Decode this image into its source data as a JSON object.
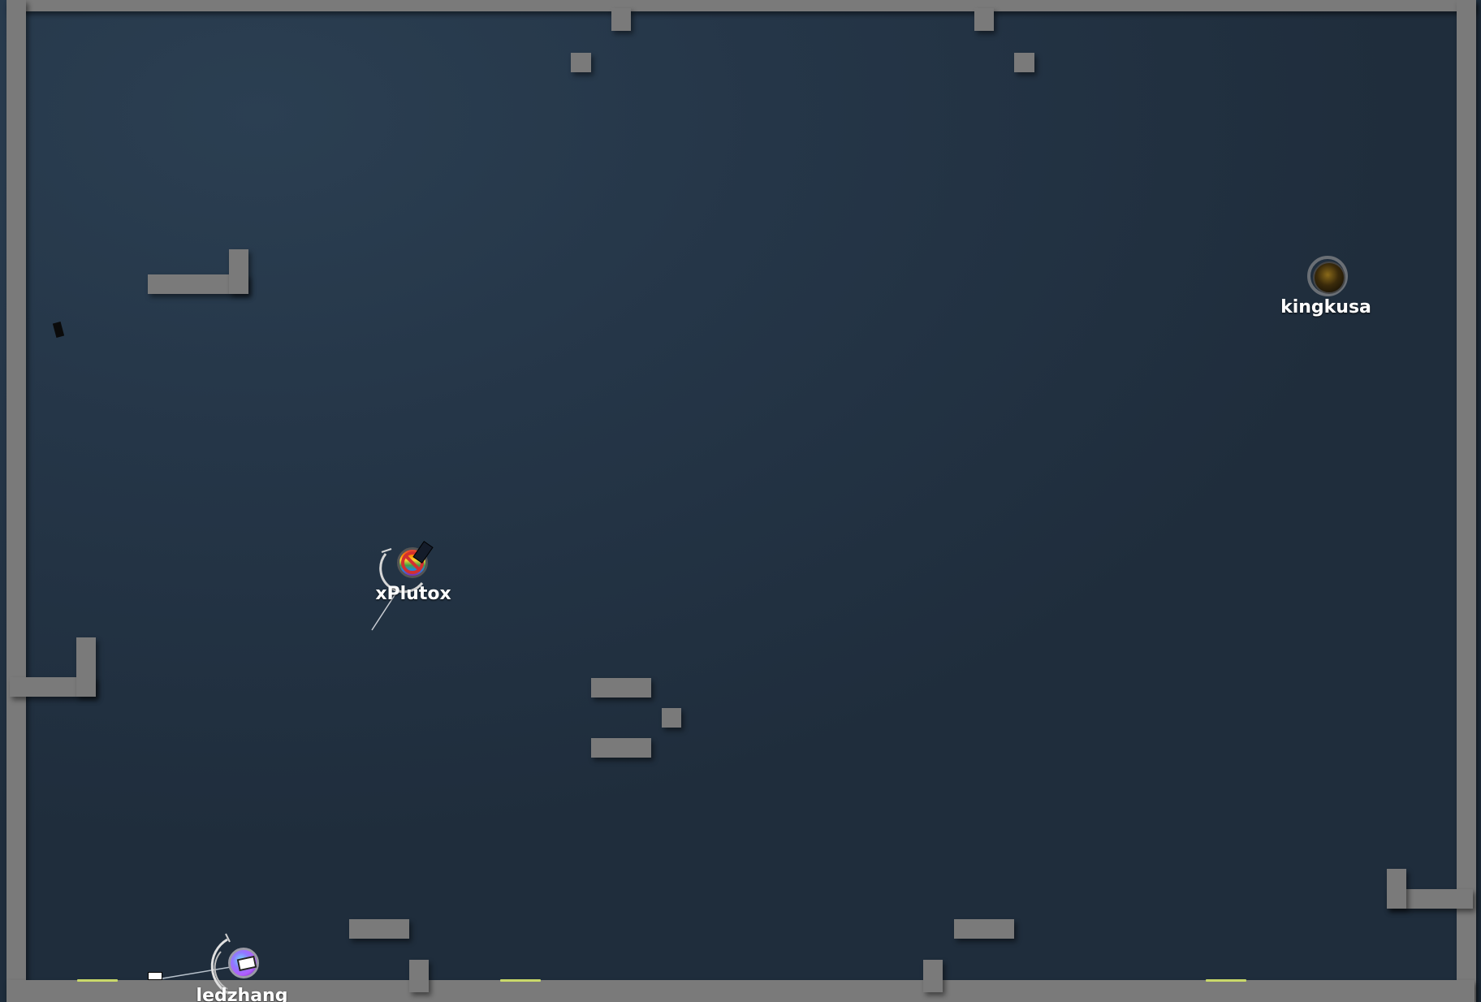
{
  "players": [
    {
      "name": "kingkusa",
      "skin": "dark-gold-skin"
    },
    {
      "name": "xPlutox",
      "skin": "rainbow-no-symbol-skin"
    },
    {
      "name": "ledzhang",
      "skin": "purple-swirl-skin"
    }
  ],
  "colors": {
    "background": "#243547",
    "wall": "#7a7a7a",
    "pad": "#c9d96a",
    "name_text": "#ffffff"
  }
}
